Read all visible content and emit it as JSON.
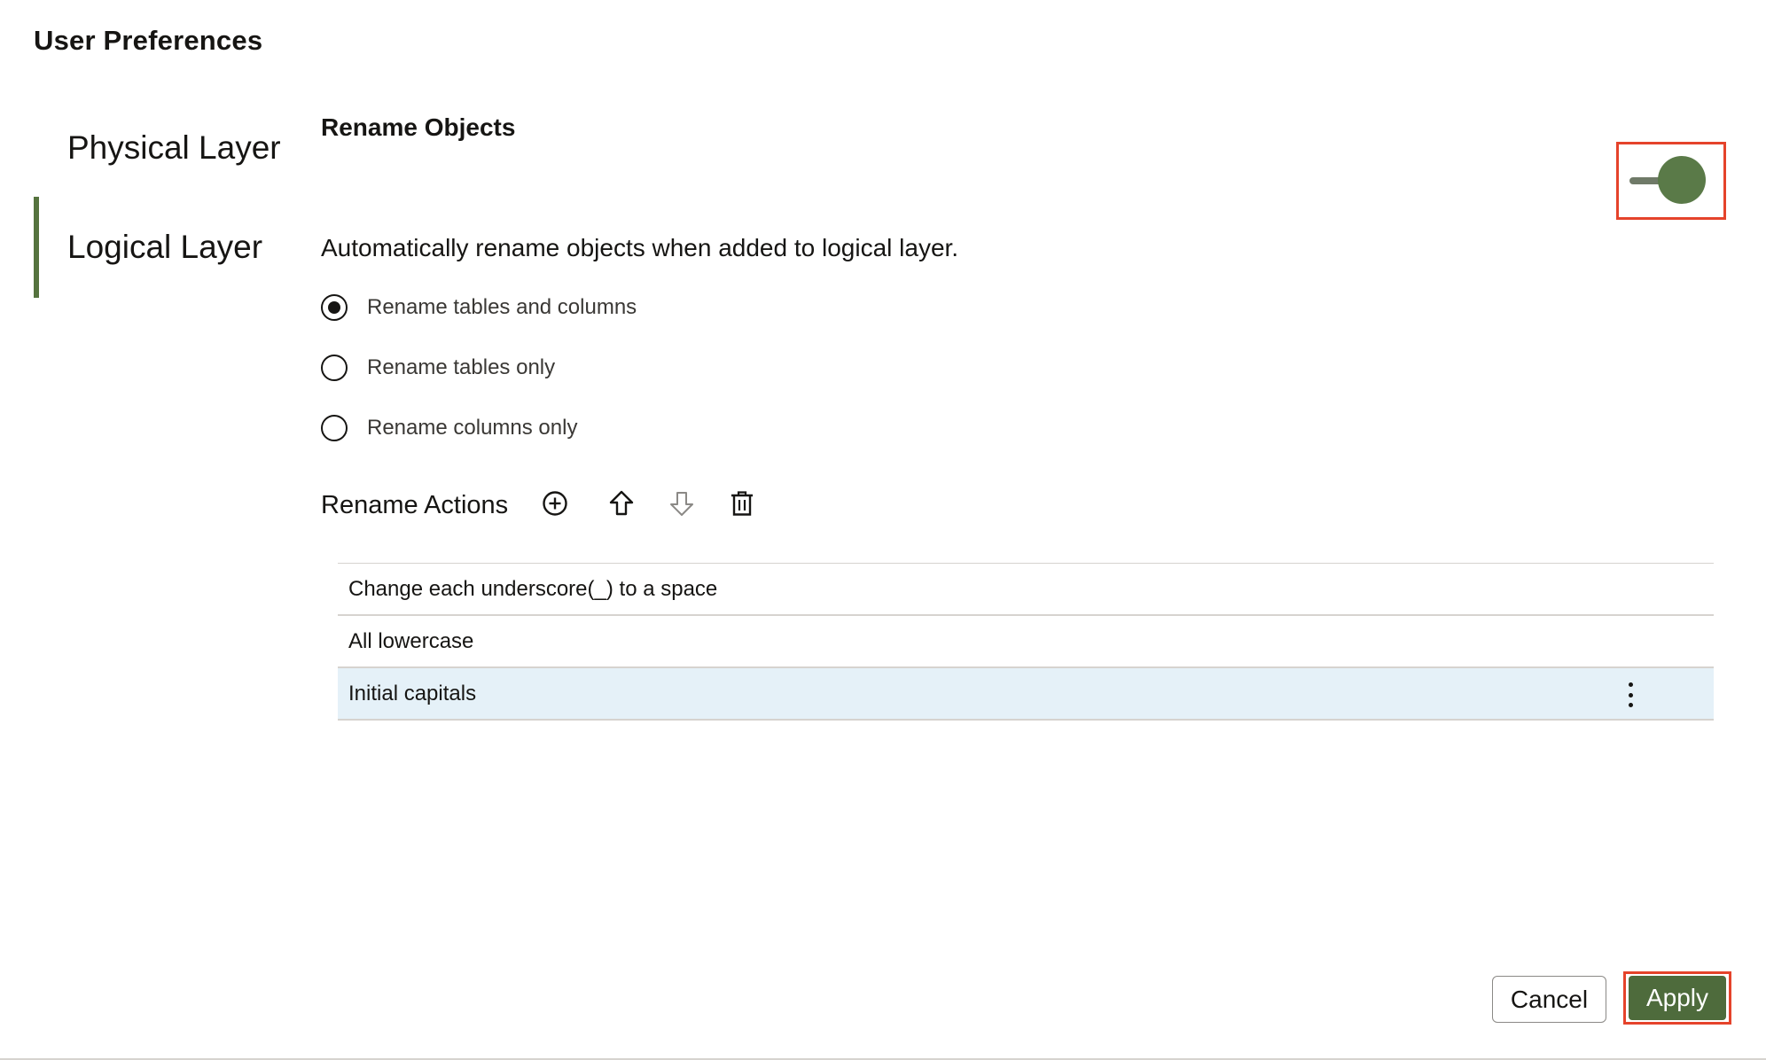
{
  "dialog": {
    "title": "User Preferences"
  },
  "nav": {
    "items": [
      {
        "label": "Physical Layer",
        "selected": false
      },
      {
        "label": "Logical Layer",
        "selected": true
      }
    ],
    "selected_color": "#55733e"
  },
  "rename_objects": {
    "title": "Rename Objects",
    "toggle_on": true,
    "description": "Automatically rename objects when added to logical layer.",
    "options": [
      {
        "label": "Rename tables and columns",
        "checked": true
      },
      {
        "label": "Rename tables only",
        "checked": false
      },
      {
        "label": "Rename columns only",
        "checked": false
      }
    ]
  },
  "rename_actions": {
    "label": "Rename Actions",
    "toolbar_icons": [
      "add-circle-icon",
      "move-up-icon",
      "move-down-icon",
      "delete-icon"
    ],
    "rows": [
      {
        "text": "Change each underscore(_) to a space"
      },
      {
        "text": "All lowercase"
      },
      {
        "text": "Initial capitals",
        "selected": true
      }
    ]
  },
  "footer": {
    "cancel_label": "Cancel",
    "apply_label": "Apply"
  },
  "colors": {
    "accent": "#4e6b3c",
    "highlight_box": "#e5432b",
    "selected_row": "#e5f1f8"
  }
}
